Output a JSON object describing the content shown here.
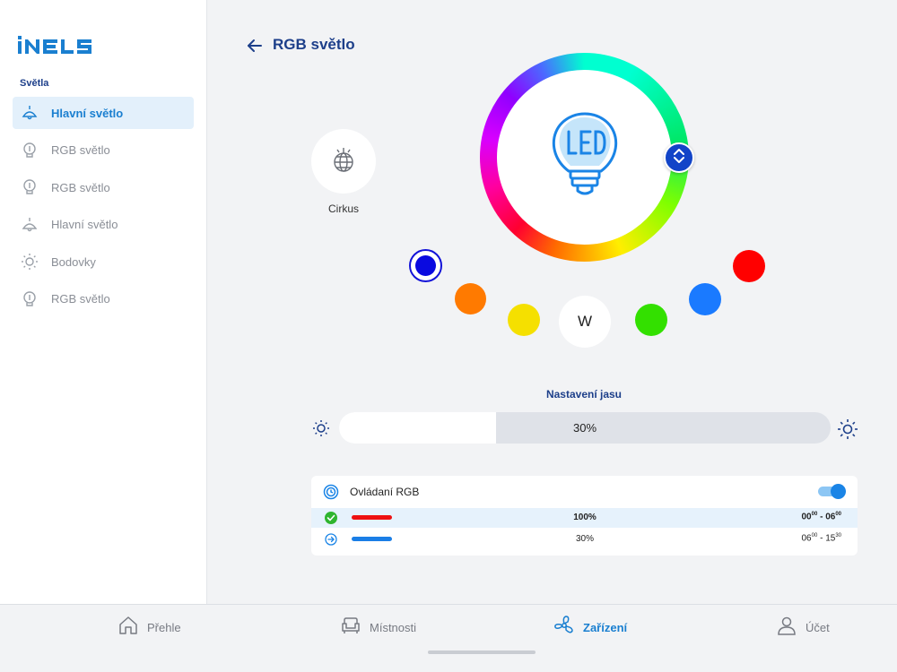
{
  "app": {
    "logo_text": "iNELS"
  },
  "sidebar": {
    "section_title": "Světla",
    "items": [
      {
        "label": "Hlavní světlo",
        "icon": "ceiling-lamp-icon",
        "active": true
      },
      {
        "label": "RGB světlo",
        "icon": "bulb-icon",
        "active": false
      },
      {
        "label": "RGB světlo",
        "icon": "bulb-icon",
        "active": false
      },
      {
        "label": "Hlavní světlo",
        "icon": "ceiling-lamp-icon",
        "active": false
      },
      {
        "label": "Bodovky",
        "icon": "sun-icon",
        "active": false
      },
      {
        "label": "RGB světlo",
        "icon": "bulb-icon",
        "active": false
      }
    ]
  },
  "header": {
    "title": "RGB světlo"
  },
  "scene": {
    "label": "Cirkus",
    "icon": "disco-ball-icon"
  },
  "wheel": {
    "center_icon": "led-bulb-icon",
    "knob_color": "#1244c8"
  },
  "presets": {
    "white_label": "W",
    "colors": {
      "selected": "#0a0ae0",
      "orange": "#ff7a00",
      "yellow": "#f5e000",
      "green": "#33e000",
      "blue": "#1a7aff",
      "red": "#ff0000"
    }
  },
  "brightness": {
    "title": "Nastavení jasu",
    "value_label": "30%",
    "value_fraction": 0.32
  },
  "schedule": {
    "title": "Ovládaní RGB",
    "enabled": true,
    "rows": [
      {
        "status": "active",
        "color": "#ee1111",
        "percent": "100%",
        "from_h": "00",
        "from_m": "00",
        "to_h": "06",
        "to_m": "00"
      },
      {
        "status": "next",
        "color": "#1a7ee6",
        "percent": "30%",
        "from_h": "06",
        "from_m": "00",
        "to_h": "15",
        "to_m": "30"
      }
    ]
  },
  "bottom_nav": [
    {
      "label": "Přehle",
      "icon": "home-icon",
      "active": false
    },
    {
      "label": "Místnosti",
      "icon": "armchair-icon",
      "active": false
    },
    {
      "label": "Zařízení",
      "icon": "fan-icon",
      "active": true
    },
    {
      "label": "Účet",
      "icon": "user-icon",
      "active": false
    }
  ]
}
